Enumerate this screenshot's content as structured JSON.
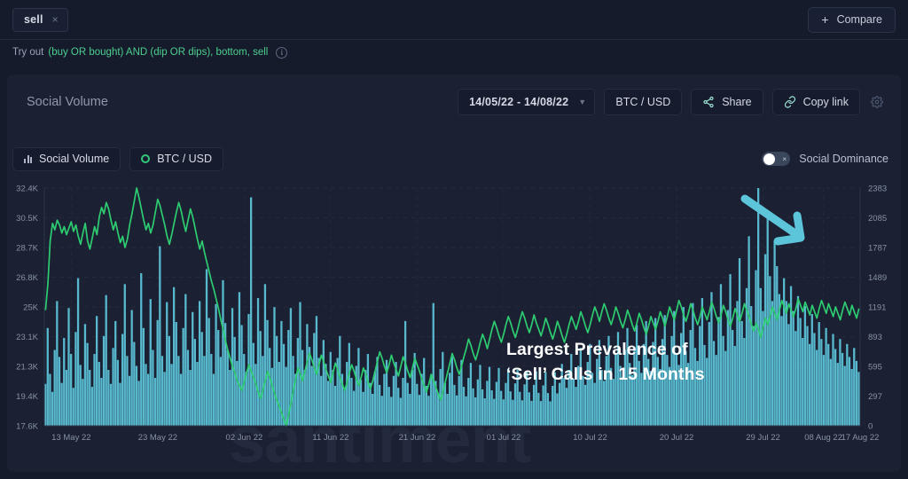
{
  "topbar": {
    "tag_label": "sell",
    "tag_close": "×",
    "compare_label": "Compare",
    "compare_plus": "+"
  },
  "hint": {
    "prefix": "Try out",
    "query": "(buy OR bought) AND (dip OR dips), bottom, sell",
    "info": "i"
  },
  "panel": {
    "title": "Social Volume",
    "date_range": "14/05/22 - 14/08/22",
    "chevron": "⌄",
    "pair": "BTC / USD",
    "share": "Share",
    "copy_link": "Copy link"
  },
  "legend": {
    "social_volume": "Social Volume",
    "btc_usd": "BTC / USD",
    "social_dominance": "Social Dominance",
    "toggle_x": "×"
  },
  "annotation": {
    "line1": "Largest Prevalence of",
    "line2": "‘Sell’ Calls in 15 Months"
  },
  "watermark": "santiment",
  "colors": {
    "bars": "#5cc5da",
    "price_line": "#2ecc71",
    "accent": "#5cc5da",
    "panel_bg": "#1b2133",
    "page_bg": "#161b2b"
  },
  "chart_data": {
    "type": "bar",
    "title": "Social Volume",
    "xlabel": "",
    "ylabel": "",
    "grid": true,
    "legend_position": "top-left",
    "y_left": {
      "name": "BTC / USD",
      "ticks": [
        "17.6K",
        "19.4K",
        "21.3K",
        "23.1K",
        "25K",
        "26.8K",
        "28.7K",
        "30.5K",
        "32.4K"
      ],
      "min": 17600,
      "max": 32400
    },
    "y_right": {
      "name": "Social Volume (sell)",
      "ticks": [
        "0",
        "297",
        "595",
        "893",
        "1191",
        "1489",
        "1787",
        "2085",
        "2383"
      ],
      "min": 0,
      "max": 2383
    },
    "x_ticks": [
      "13 May 22",
      "23 May 22",
      "02 Jun 22",
      "11 Jun 22",
      "21 Jun 22",
      "01 Jul 22",
      "10 Jul 22",
      "20 Jul 22",
      "29 Jul 22",
      "08 Aug 22",
      "17 Aug 22"
    ],
    "x_tick_positions": [
      0.033,
      0.139,
      0.245,
      0.351,
      0.457,
      0.563,
      0.669,
      0.775,
      0.881,
      0.955,
      1.0
    ],
    "series": [
      {
        "name": "Social Volume",
        "type": "bar",
        "color": "#5cc5da",
        "axis": "right",
        "values": [
          420,
          980,
          520,
          340,
          760,
          1250,
          690,
          430,
          880,
          560,
          1180,
          720,
          380,
          940,
          1480,
          610,
          470,
          1020,
          830,
          560,
          390,
          720,
          1100,
          640,
          480,
          900,
          1310,
          560,
          420,
          780,
          1050,
          660,
          430,
          920,
          1420,
          700,
          500,
          1160,
          840,
          600,
          450,
          1530,
          980,
          620,
          520,
          1270,
          760,
          480,
          1060,
          1800,
          700,
          540,
          1240,
          900,
          620,
          1390,
          1040,
          700,
          520,
          980,
          1320,
          760,
          560,
          1140,
          870,
          640,
          1250,
          940,
          700,
          1570,
          1080,
          720,
          520,
          1220,
          960,
          690,
          1460,
          1030,
          760,
          560,
          1180,
          890,
          650,
          1340,
          1010,
          720,
          540,
          1120,
          2290,
          830,
          620,
          1280,
          950,
          700,
          1420,
          1060,
          780,
          580,
          1190,
          900,
          640,
          1050,
          820,
          590,
          960,
          1180,
          700,
          520,
          880,
          1240,
          760,
          560,
          1020,
          790,
          600,
          930,
          1100,
          680,
          500,
          860,
          620,
          450,
          740,
          560,
          400,
          680,
          900,
          520,
          380,
          640,
          830,
          480,
          350,
          600,
          780,
          460,
          340,
          560,
          720,
          430,
          320,
          540,
          690,
          410,
          300,
          520,
          660,
          390,
          290,
          500,
          640,
          380,
          280,
          480,
          1050,
          430,
          320,
          560,
          730,
          420,
          310,
          520,
          680,
          400,
          300,
          490,
          1230,
          450,
          330,
          570,
          740,
          430,
          320,
          530,
          690,
          410,
          305,
          500,
          660,
          390,
          295,
          480,
          630,
          375,
          285,
          465,
          610,
          365,
          275,
          450,
          590,
          355,
          270,
          440,
          580,
          350,
          265,
          430,
          570,
          345,
          260,
          425,
          560,
          340,
          255,
          415,
          550,
          335,
          250,
          410,
          545,
          330,
          248,
          405,
          540,
          328,
          245,
          400,
          535,
          325,
          430,
          620,
          480,
          380,
          560,
          720,
          470,
          390,
          600,
          780,
          500,
          410,
          640,
          820,
          530,
          430,
          670,
          860,
          560,
          450,
          700,
          900,
          580,
          470,
          730,
          940,
          600,
          490,
          760,
          980,
          630,
          510,
          790,
          1010,
          650,
          530,
          820,
          1050,
          670,
          550,
          840,
          1080,
          690,
          570,
          870,
          1110,
          710,
          590,
          900,
          1150,
          730,
          610,
          930,
          1190,
          750,
          630,
          960,
          1230,
          780,
          650,
          1000,
          1280,
          810,
          680,
          1040,
          1340,
          850,
          710,
          1090,
          1420,
          900,
          750,
          1160,
          1520,
          960,
          800,
          1250,
          1680,
          1050,
          880,
          1380,
          1900,
          1200,
          1000,
          1560,
          2383,
          1380,
          1150,
          1720,
          2150,
          1500,
          1250,
          1850,
          1600,
          1320,
          1100,
          1480,
          1250,
          1020,
          1400,
          1150,
          950,
          1300,
          1080,
          880,
          1200,
          1000,
          820,
          1120,
          930,
          760,
          1040,
          870,
          710,
          980,
          820,
          670,
          920,
          770,
          630,
          870,
          730,
          600,
          820,
          690,
          570,
          780,
          650,
          540
        ]
      },
      {
        "name": "BTC / USD",
        "type": "line",
        "color": "#2ecc71",
        "axis": "left",
        "values": [
          24800,
          26400,
          29100,
          30200,
          29800,
          30400,
          30100,
          29600,
          30000,
          29500,
          29900,
          30300,
          29700,
          30100,
          29400,
          28900,
          29600,
          30200,
          29100,
          28600,
          29300,
          30000,
          29500,
          30600,
          31200,
          30800,
          31500,
          31100,
          30400,
          29800,
          30300,
          29600,
          29000,
          29400,
          28700,
          29200,
          30100,
          30800,
          31600,
          32400,
          31800,
          31100,
          30400,
          29800,
          30200,
          29600,
          30100,
          30900,
          31700,
          31300,
          30700,
          30100,
          29400,
          28900,
          29500,
          30200,
          30900,
          31500,
          31000,
          30300,
          29700,
          30400,
          31100,
          30600,
          29900,
          29200,
          28600,
          29100,
          28400,
          27800,
          27200,
          26600,
          26100,
          25500,
          24900,
          24200,
          23600,
          22900,
          22300,
          21800,
          21300,
          20900,
          20400,
          20100,
          19800,
          20300,
          20900,
          21400,
          21000,
          20600,
          20200,
          19700,
          19300,
          19800,
          20400,
          21000,
          20600,
          20100,
          19600,
          19200,
          18800,
          18400,
          18000,
          17600,
          18300,
          19000,
          19800,
          20500,
          21200,
          20800,
          20400,
          21000,
          21600,
          22100,
          21700,
          21200,
          20800,
          21400,
          22000,
          21600,
          21100,
          20700,
          20300,
          20900,
          21500,
          21100,
          20600,
          20200,
          19800,
          20300,
          20900,
          21400,
          21000,
          20500,
          20100,
          20600,
          21200,
          20800,
          20300,
          19900,
          20400,
          21000,
          21600,
          22200,
          21800,
          21300,
          20900,
          21400,
          22000,
          21500,
          21100,
          20700,
          21300,
          21900,
          21500,
          21000,
          20600,
          21200,
          21800,
          21400,
          21000,
          20500,
          20100,
          19700,
          20200,
          20800,
          20400,
          20000,
          19600,
          19200,
          19700,
          20300,
          20900,
          21500,
          22100,
          21700,
          21200,
          20800,
          21300,
          21900,
          22400,
          23000,
          22600,
          22100,
          21700,
          22200,
          22800,
          23300,
          22900,
          22400,
          23000,
          23600,
          24100,
          23700,
          23200,
          22800,
          23300,
          23900,
          24400,
          24000,
          23500,
          23100,
          23600,
          24200,
          24700,
          24300,
          23800,
          23400,
          23900,
          24500,
          24000,
          23600,
          23200,
          23700,
          24300,
          23900,
          23400,
          23000,
          23500,
          24100,
          23700,
          23200,
          22800,
          23300,
          23900,
          24400,
          24000,
          23600,
          24100,
          24700,
          24300,
          23800,
          23400,
          23900,
          24500,
          25000,
          24600,
          24100,
          24700,
          25200,
          24800,
          24300,
          23900,
          24400,
          25000,
          24600,
          24100,
          23700,
          24200,
          24800,
          24400,
          23900,
          23500,
          24000,
          24600,
          24200,
          23700,
          23300,
          23800,
          24400,
          24000,
          23600,
          24100,
          24700,
          24300,
          23800,
          24400,
          25000,
          24600,
          24200,
          24800,
          25400,
          25000,
          24500,
          24100,
          24600,
          25200,
          24800,
          24300,
          23900,
          24400,
          25000,
          24600,
          24200,
          24700,
          25300,
          24900,
          24400,
          24000,
          24500,
          25100,
          24700,
          24200,
          23800,
          24300,
          24900,
          24500,
          24100,
          24600,
          25200,
          24800,
          24400,
          23900,
          23500,
          24000,
          23600,
          23100,
          23700,
          24300,
          23900,
          24400,
          25000,
          24600,
          24200,
          24800,
          25400,
          25000,
          24600,
          25200,
          24800,
          24400,
          24900,
          25500,
          25100,
          24700,
          25300,
          24900,
          24500,
          25100,
          24700,
          24300,
          24900,
          25400,
          25000,
          24600,
          25200,
          24800,
          24400,
          25000,
          24600,
          24200,
          24800,
          25300,
          24900,
          24500,
          25100,
          24700,
          24300,
          24900
        ]
      }
    ],
    "annotation": {
      "text": "Largest Prevalence of ‘Sell’ Calls in 15 Months",
      "points_to_x": "08 Aug 22",
      "points_to_value": 2383
    }
  }
}
